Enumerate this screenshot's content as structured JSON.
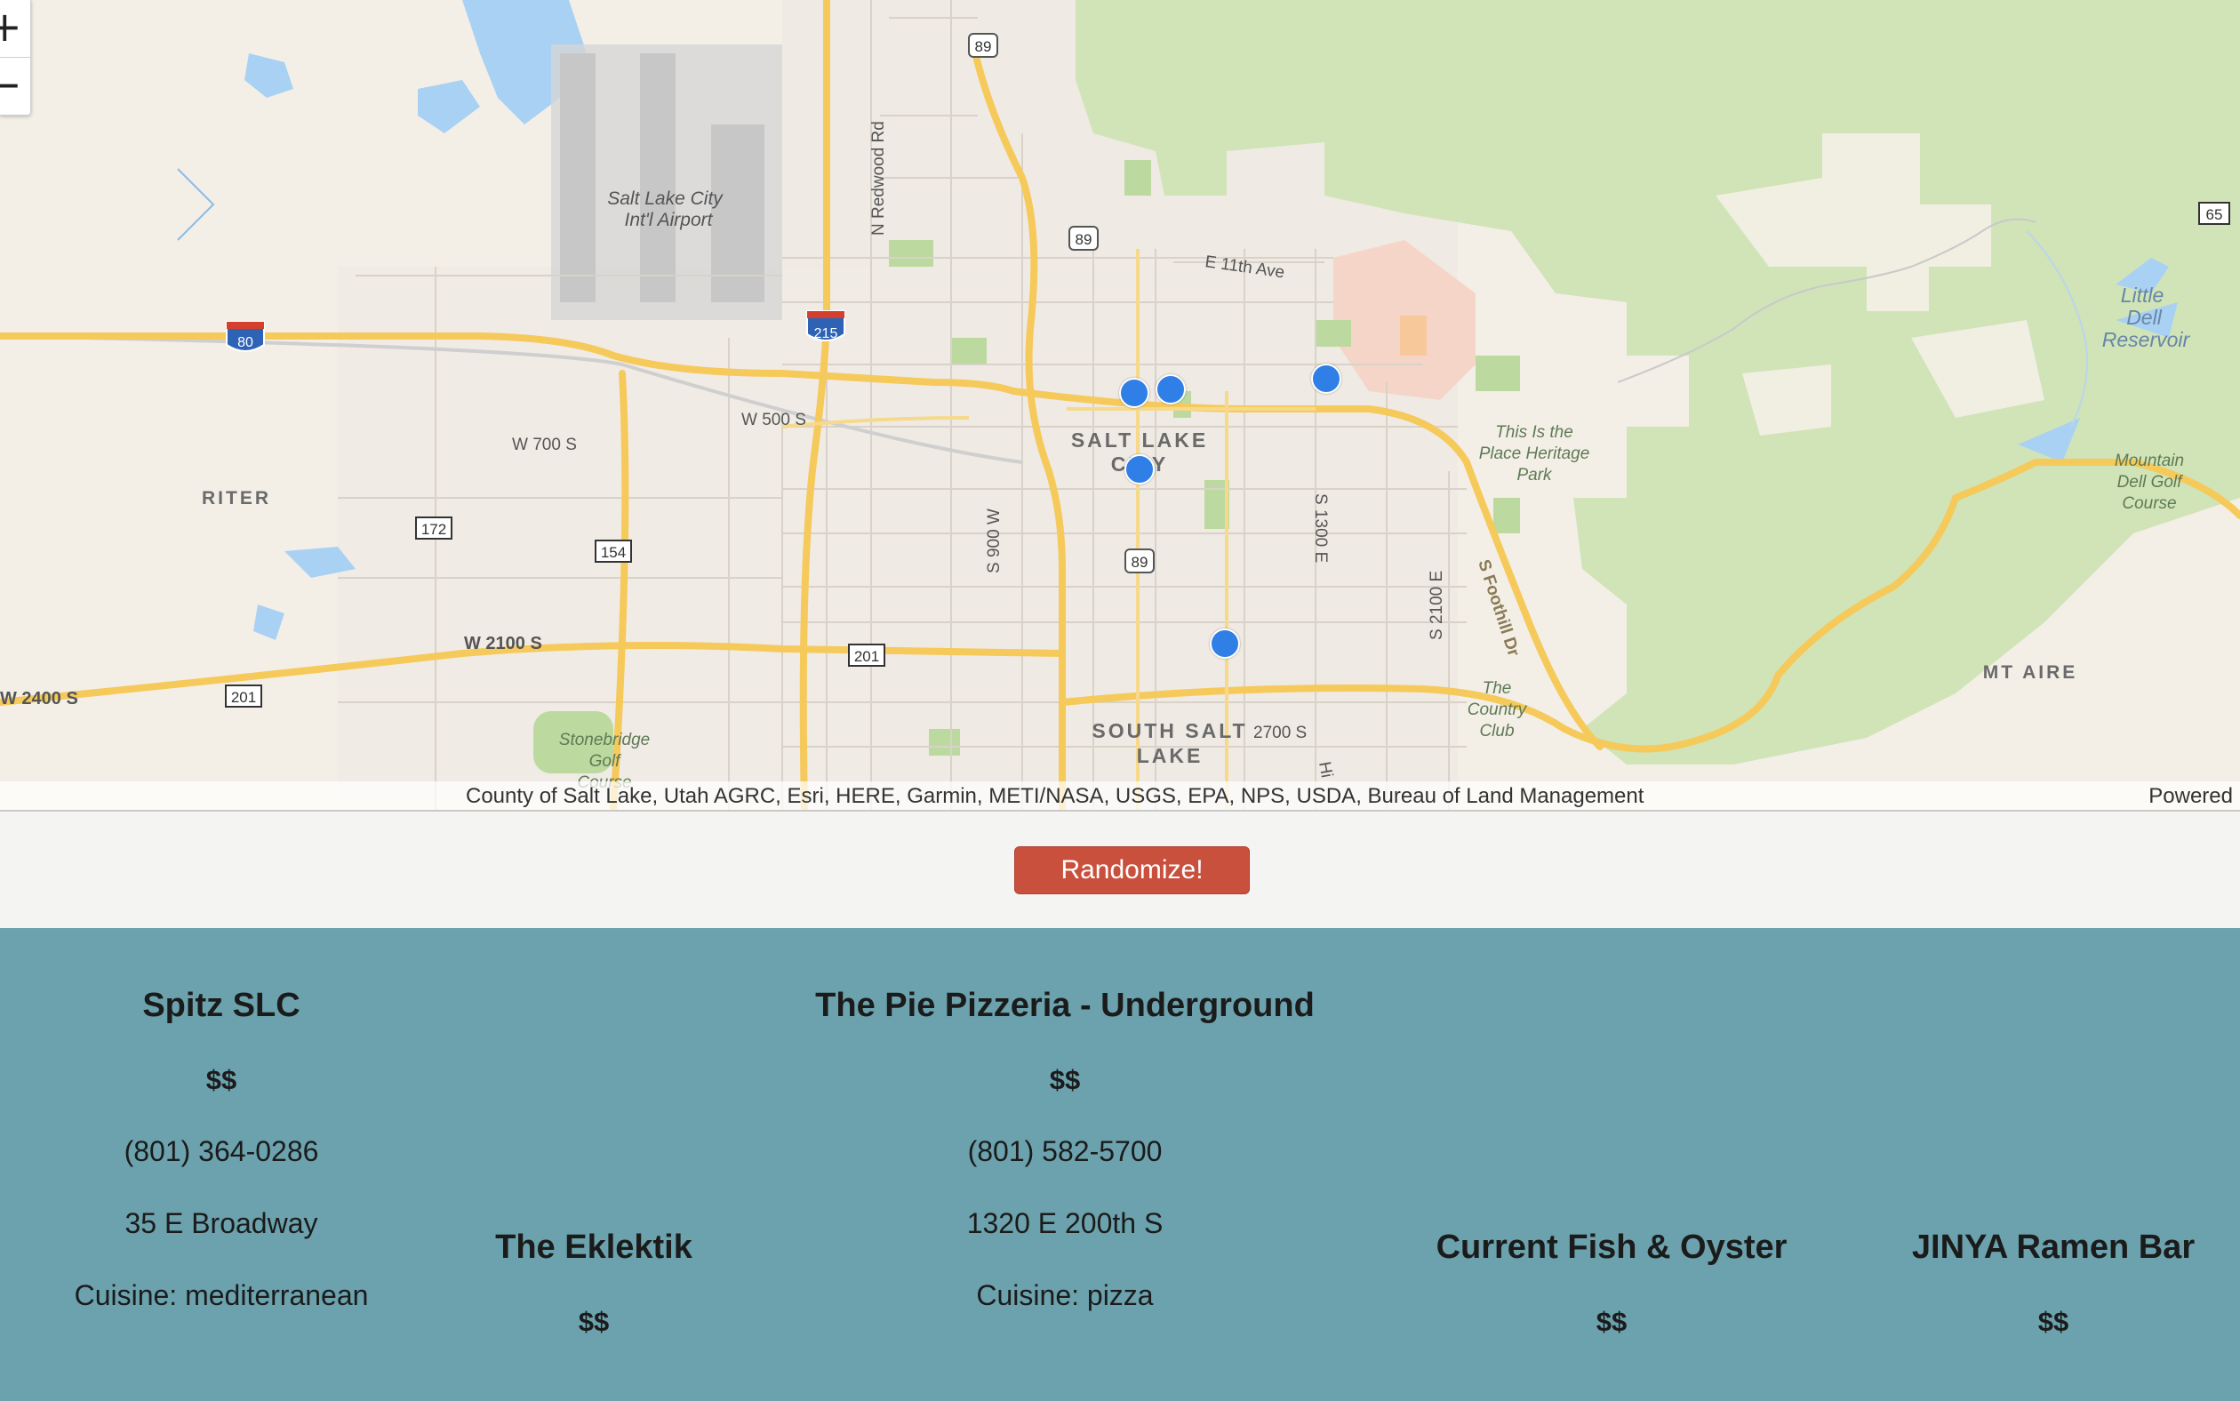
{
  "map": {
    "zoom_in": "+",
    "zoom_out": "−",
    "attribution": "County of Salt Lake, Utah AGRC, Esri, HERE, Garmin, METI/NASA, USGS, EPA, NPS, USDA, Bureau of Land Management",
    "powered": "Powered",
    "labels": {
      "airport_1": "Salt Lake City",
      "airport_2": "Int'l Airport",
      "city_1": "SALT LAKE",
      "city_2": "CITY",
      "south_salt_1": "SOUTH SALT",
      "south_salt_2": "LAKE",
      "riter": "RITER",
      "mt_aire": "MT AIRE",
      "little_dell_1": "Little",
      "little_dell_2": "Dell",
      "little_dell_3": "Reservoir",
      "mountain_dell_1": "Mountain",
      "mountain_dell_2": "Dell Golf",
      "mountain_dell_3": "Course",
      "heritage_1": "This Is the",
      "heritage_2": "Place Heritage",
      "heritage_3": "Park",
      "country_club_1": "The",
      "country_club_2": "Country",
      "country_club_3": "Club",
      "stonebridge_1": "Stonebridge",
      "stonebridge_2": "Golf",
      "stonebridge_3": "Course",
      "w500": "W 500 S",
      "w700": "W 700 S",
      "w2100": "W 2100 S",
      "w2400": "W 2400 S",
      "e11th": "E 11th Ave",
      "e2700": "2700 S",
      "s900w": "S 900 W",
      "s1300e": "S 1300 E",
      "s2100e": "S 2100 E",
      "sfoothill": "S Foothill Dr",
      "nredwood": "N Redwood Rd",
      "shi": "Hi",
      "sh_89a": "89",
      "sh_89b": "89",
      "sh_89c": "89",
      "sh_172": "172",
      "sh_154": "154",
      "sh_201a": "201",
      "sh_201b": "201",
      "sh_65": "65",
      "i_80": "80",
      "i_215": "215"
    },
    "markers_count_note": ""
  },
  "button": {
    "label": "Randomize!"
  },
  "restaurants": [
    {
      "name": "Spitz SLC",
      "price": "$$",
      "phone": "(801) 364-0286",
      "address": "35 E Broadway",
      "cuisine": "Cuisine: mediterranean"
    },
    {
      "name": "The Eklektik",
      "price": "$$"
    },
    {
      "name": "The Pie Pizzeria - Underground",
      "price": "$$",
      "phone": "(801) 582-5700",
      "address": "1320 E 200th S",
      "cuisine": "Cuisine: pizza"
    },
    {
      "name": "Current Fish & Oyster",
      "price": "$$"
    },
    {
      "name": "JINYA Ramen Bar",
      "price": "$$"
    }
  ]
}
